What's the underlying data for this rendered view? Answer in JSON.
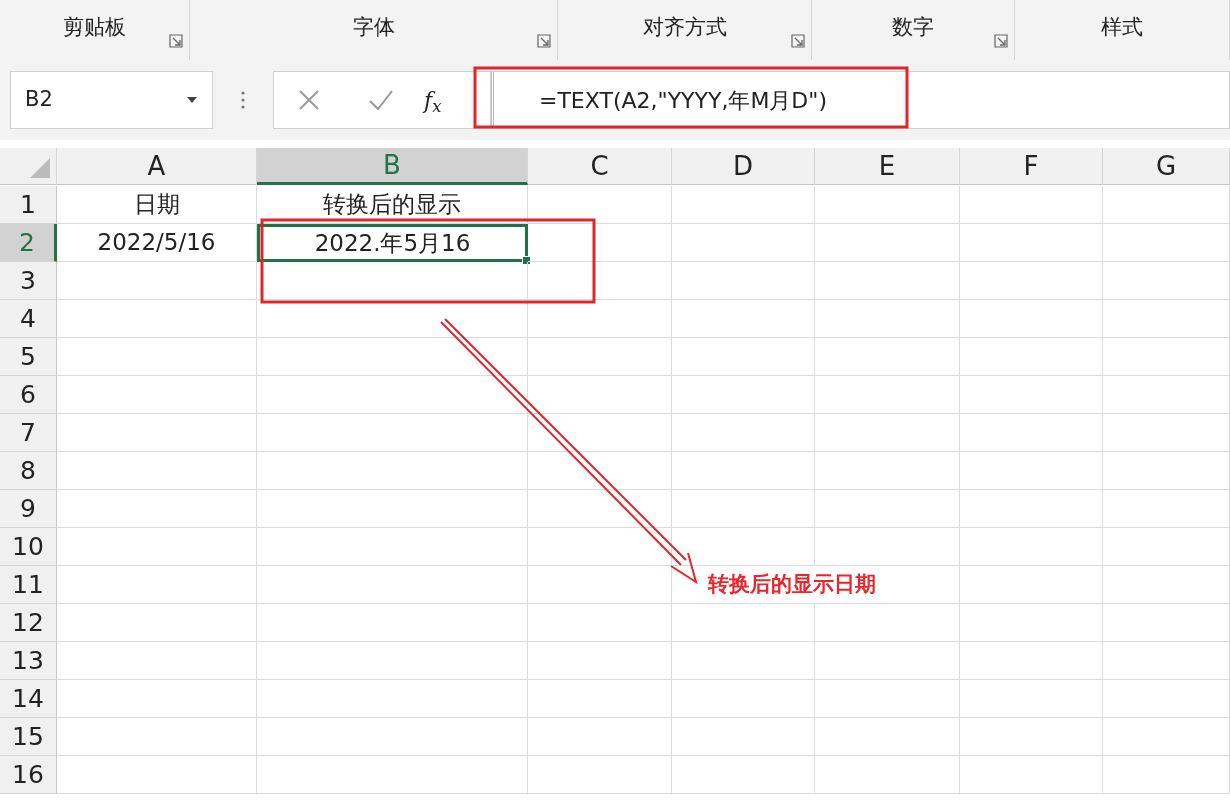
{
  "ribbon_groups": [
    {
      "label": "剪贴板",
      "launcher": true
    },
    {
      "label": "字体",
      "launcher": true
    },
    {
      "label": "对齐方式",
      "launcher": true
    },
    {
      "label": "数字",
      "launcher": true
    },
    {
      "label": "样式",
      "launcher": false
    }
  ],
  "name_box": {
    "value": "B2"
  },
  "formula_bar": {
    "fx_label": "f$_{x}$",
    "formula": "=TEXT(A2,\"YYYY,年M月D\")"
  },
  "columns": [
    {
      "label": "A",
      "selected": false
    },
    {
      "label": "B",
      "selected": true
    },
    {
      "label": "C",
      "selected": false
    },
    {
      "label": "D",
      "selected": false
    },
    {
      "label": "E",
      "selected": false
    },
    {
      "label": "F",
      "selected": false
    },
    {
      "label": "G",
      "selected": false
    }
  ],
  "rows": [
    {
      "label": "1",
      "selected": false,
      "cells": [
        "日期",
        "转换后的显示"
      ]
    },
    {
      "label": "2",
      "selected": true,
      "cells": [
        "2022/5/16",
        "2022.年5月16"
      ]
    },
    {
      "label": "3",
      "selected": false
    },
    {
      "label": "4",
      "selected": false
    },
    {
      "label": "5",
      "selected": false
    },
    {
      "label": "6",
      "selected": false
    },
    {
      "label": "7",
      "selected": false
    },
    {
      "label": "8",
      "selected": false
    },
    {
      "label": "9",
      "selected": false
    },
    {
      "label": "10",
      "selected": false
    },
    {
      "label": "11",
      "selected": false
    },
    {
      "label": "12",
      "selected": false
    },
    {
      "label": "13",
      "selected": false
    },
    {
      "label": "14",
      "selected": false
    },
    {
      "label": "15",
      "selected": false
    },
    {
      "label": "16",
      "selected": false
    }
  ],
  "annotation": {
    "callout": "转换后的显示日期"
  }
}
